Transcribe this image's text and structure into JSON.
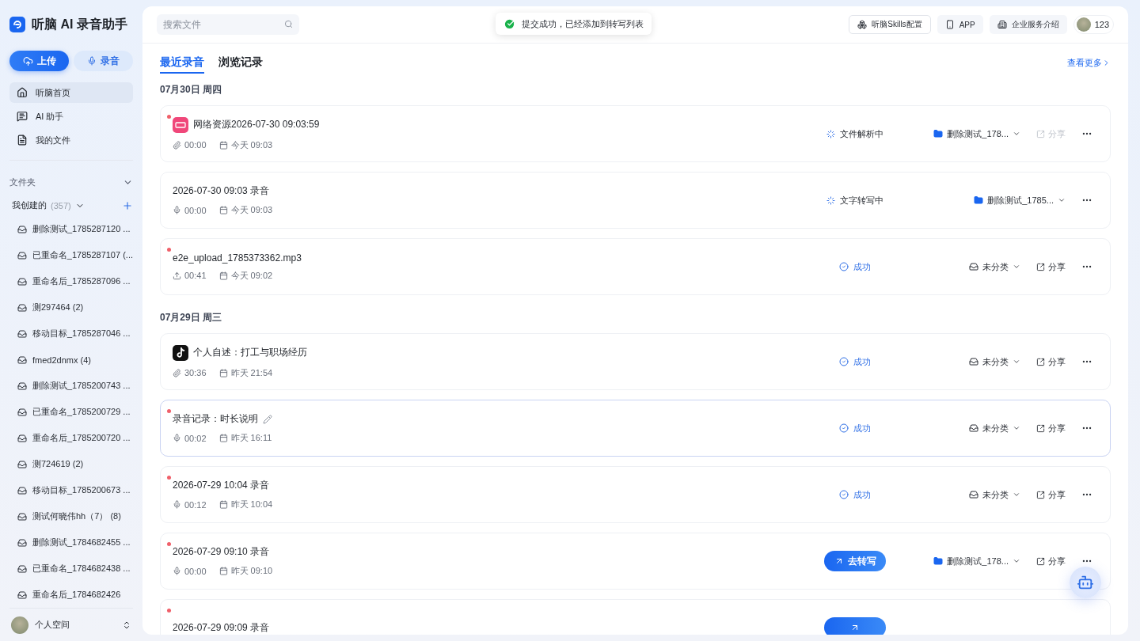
{
  "app": {
    "title": "听脑 AI 录音助手"
  },
  "actions": [
    {
      "kind": "primary",
      "label": "上传"
    },
    {
      "kind": "secondary",
      "label": "录音"
    }
  ],
  "nav": [
    {
      "kind": "home",
      "label": "听脑首页",
      "selected": true
    },
    {
      "kind": "assistant",
      "label": "AI 助手",
      "selected": false
    },
    {
      "kind": "files",
      "label": "我的文件",
      "selected": false
    }
  ],
  "folders": {
    "title": "文件夹",
    "expanded": true,
    "group": {
      "label": "我创建的",
      "count": "(357)",
      "expanded": true
    },
    "items": [
      "删除测试_1785287120 ...",
      "已重命名_1785287107 (...",
      "重命名后_1785287096 ...",
      "测297464 (2)",
      "移动目标_1785287046 ...",
      "fmed2dnmx (4)",
      "删除测试_1785200743 ...",
      "已重命名_1785200729 ...",
      "重命名后_1785200720 ...",
      "测724619 (2)",
      "移动目标_1785200673 ...",
      "测试何晓伟hh（7） (8)",
      "删除测试_1784682455 ...",
      "已重命名_1784682438 ...",
      "重命名后_1784682426"
    ]
  },
  "space": {
    "label": "个人空间"
  },
  "search": {
    "placeholder": "搜索文件"
  },
  "toast": {
    "text": "提交成功，已经添加到转写列表"
  },
  "header_buttons": [
    {
      "kind": "skills",
      "label": "听脑Skills配置"
    },
    {
      "kind": "app",
      "label": "APP"
    },
    {
      "kind": "enterprise",
      "label": "企业服务介绍"
    }
  ],
  "user": {
    "name": "123"
  },
  "tabs": [
    {
      "label": "最近录音",
      "selected": true
    },
    {
      "label": "浏览记录",
      "selected": false
    }
  ],
  "more_link": "查看更多",
  "days": [
    {
      "date": "07月30日 周四",
      "records": [
        {
          "title": "网络资源2026-07-30 09:03:59",
          "unread": true,
          "origin": {
            "kind": "pink-app"
          },
          "kind": "link",
          "duration": "00:00",
          "time": "今天 09:03",
          "status": {
            "kind": "parsing",
            "label": "文件解析中"
          },
          "folder": {
            "kind": "named",
            "label": "删除测试_178..."
          },
          "share": {
            "label": "分享",
            "disabled": true
          }
        },
        {
          "title": "2026-07-30 09:03 录音",
          "unread": false,
          "kind": "mic",
          "duration": "00:00",
          "time": "今天 09:03",
          "status": {
            "kind": "transcribing",
            "label": "文字转写中"
          },
          "folder": {
            "kind": "named",
            "label": "删除测试_1785..."
          }
        },
        {
          "title": "e2e_upload_1785373362.mp3",
          "unread": true,
          "kind": "upload",
          "duration": "00:41",
          "time": "今天 09:02",
          "status": {
            "kind": "success",
            "label": "成功"
          },
          "folder": {
            "kind": "none",
            "label": "未分类"
          },
          "share": {
            "label": "分享",
            "disabled": false
          }
        }
      ]
    },
    {
      "date": "07月29日 周三",
      "records": [
        {
          "title": "个人自述：打工与职场经历",
          "unread": false,
          "origin": {
            "kind": "tiktok"
          },
          "kind": "link",
          "duration": "30:36",
          "time": "昨天 21:54",
          "status": {
            "kind": "success",
            "label": "成功"
          },
          "folder": {
            "kind": "none",
            "label": "未分类"
          },
          "share": {
            "label": "分享",
            "disabled": false
          }
        },
        {
          "title": "录音记录：时长说明",
          "unread": true,
          "selected": true,
          "kind": "mic",
          "duration": "00:02",
          "time": "昨天 16:11",
          "status": {
            "kind": "success",
            "label": "成功"
          },
          "folder": {
            "kind": "none",
            "label": "未分类"
          },
          "share": {
            "label": "分享",
            "disabled": false
          }
        },
        {
          "title": "2026-07-29 10:04 录音",
          "unread": true,
          "kind": "mic",
          "duration": "00:12",
          "time": "昨天 10:04",
          "status": {
            "kind": "success",
            "label": "成功"
          },
          "folder": {
            "kind": "none",
            "label": "未分类"
          },
          "share": {
            "label": "分享",
            "disabled": false
          }
        },
        {
          "title": "2026-07-29 09:10 录音",
          "unread": true,
          "kind": "mic",
          "duration": "00:00",
          "time": "昨天 09:10",
          "status": {
            "kind": "transcribe",
            "label": "去转写"
          },
          "folder": {
            "kind": "named",
            "label": "删除测试_178..."
          },
          "share": {
            "label": "分享",
            "disabled": false
          }
        },
        {
          "title": "2026-07-29 09:09 录音",
          "unread": true,
          "status": {
            "kind": "transcribe"
          }
        }
      ]
    }
  ]
}
